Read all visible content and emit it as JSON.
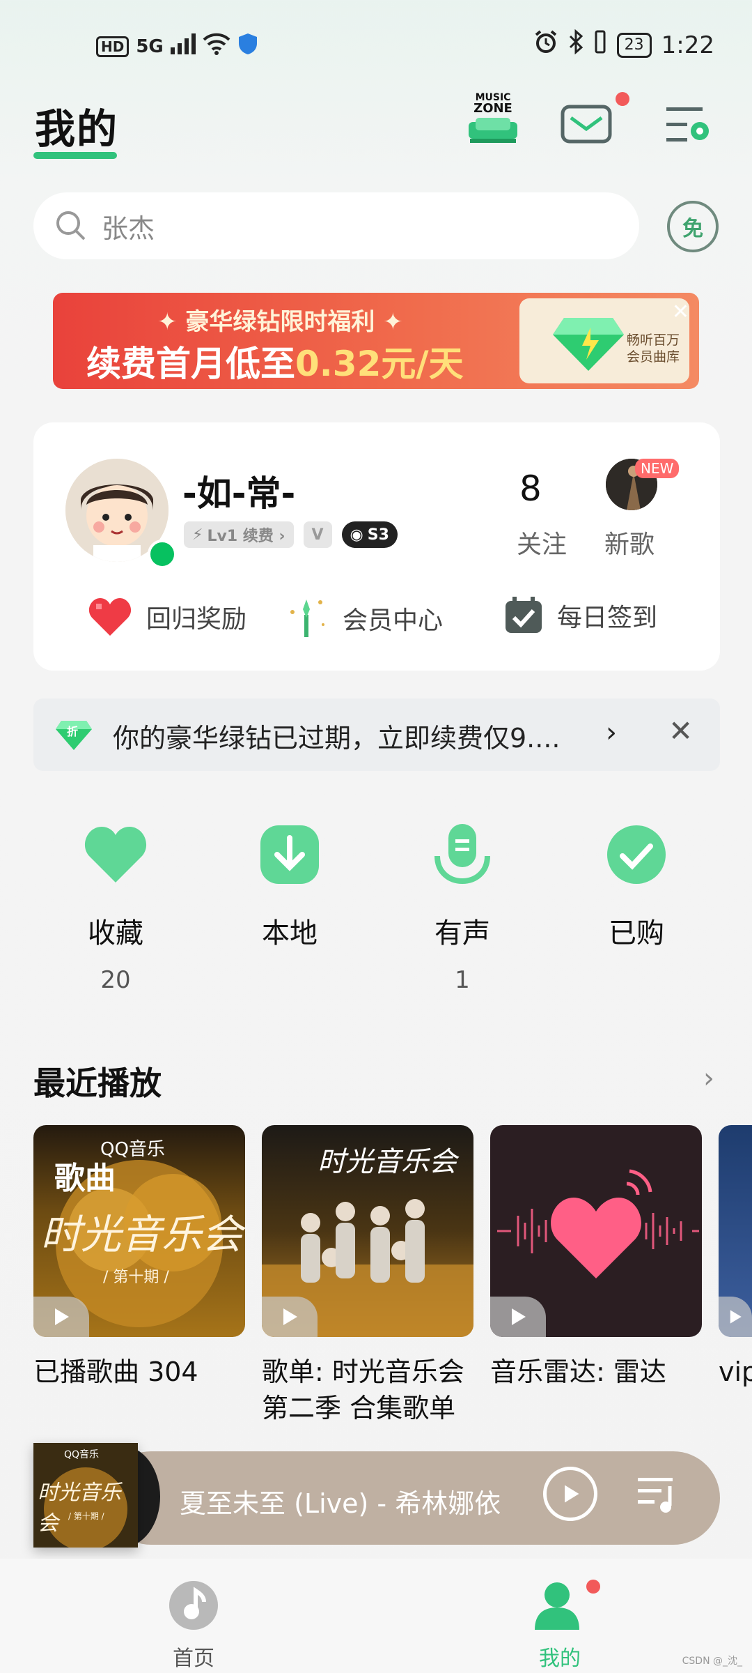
{
  "status_bar": {
    "hd": "HD",
    "network": "5G",
    "battery": "23",
    "time": "1:22"
  },
  "header": {
    "title": "我的",
    "music_zone_line1": "MUSIC",
    "music_zone_line2": "ZONE"
  },
  "search": {
    "placeholder": "张杰",
    "free_badge": "免"
  },
  "banner": {
    "line1": "✦ 豪华绿钻限时福利 ✦",
    "line2_prefix": "续费首月低至",
    "line2_price": "0.32元/天",
    "side_line1": "畅听百万",
    "side_line2": "会员曲库"
  },
  "profile": {
    "username": "-如-常-",
    "badge_level": "Lv1 续费 ›",
    "badge_v": "V",
    "badge_s": "S3",
    "follow_count": "8",
    "follow_label": "关注",
    "new_tag": "NEW",
    "new_song_label": "新歌",
    "quick_actions": [
      "回归奖励",
      "会员中心",
      "每日签到"
    ]
  },
  "notice": {
    "discount_tag": "折",
    "text": "你的豪华绿钻已过期，立即续费仅9....",
    "chevron": "›",
    "close": "✕"
  },
  "shortcuts": [
    {
      "label": "收藏",
      "count": "20"
    },
    {
      "label": "本地",
      "count": ""
    },
    {
      "label": "有声",
      "count": "1"
    },
    {
      "label": "已购",
      "count": ""
    }
  ],
  "recent": {
    "title": "最近播放",
    "more": "›",
    "tiles": [
      {
        "overlay_label": "歌曲",
        "brand": "QQ音乐",
        "art_title": "时光音乐会",
        "art_sub": "/ 第十期 /",
        "caption_line1": "已播歌曲 304",
        "caption_line2": ""
      },
      {
        "overlay_label": "",
        "brand": "",
        "art_title": "时光音乐会",
        "art_sub": "",
        "caption_line1": "歌单: 时光音乐会",
        "caption_line2": "第二季 合集歌单"
      },
      {
        "overlay_label": "",
        "brand": "",
        "art_title": "",
        "art_sub": "",
        "caption_line1": "音乐雷达: 雷达",
        "caption_line2": ""
      },
      {
        "overlay_label": "",
        "brand": "",
        "art_title": "",
        "art_sub": "",
        "caption_line1": "vip",
        "caption_line2": ""
      }
    ]
  },
  "player": {
    "brand": "QQ音乐",
    "art_title": "时光音乐会",
    "art_sub": "/ 第十期 /",
    "now_playing": "夏至未至 (Live) - 希林娜依高"
  },
  "bottom_nav": [
    {
      "label": "首页",
      "active": false
    },
    {
      "label": "我的",
      "active": true
    }
  ],
  "colors": {
    "accent": "#31c27c",
    "banner_red": "#e9423b",
    "notification_dot": "#f25a5a"
  },
  "watermark": "CSDN @_沈_"
}
